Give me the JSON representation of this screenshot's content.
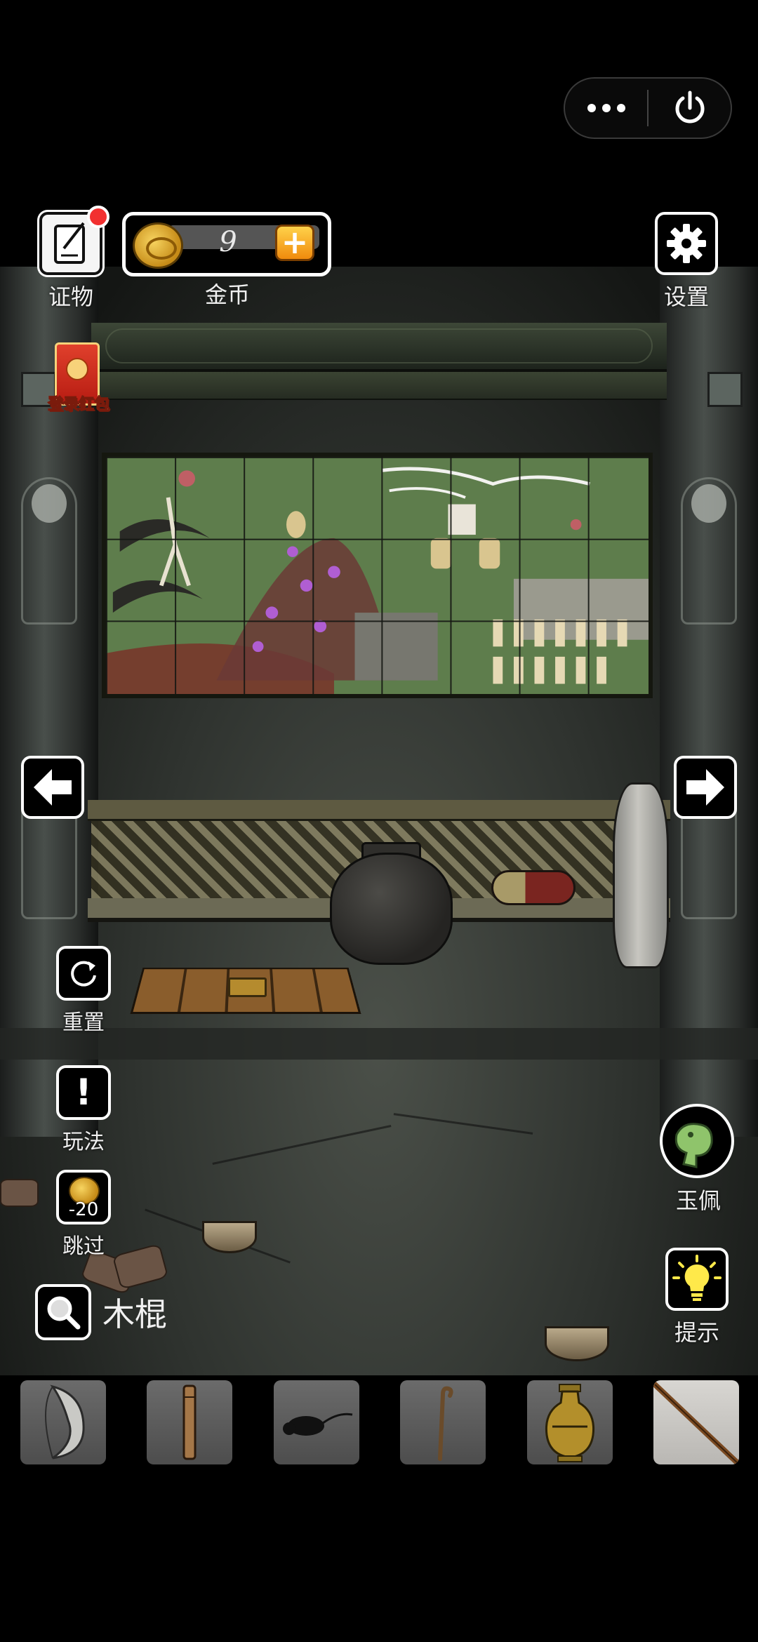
{
  "hud": {
    "evidence_label": "证物",
    "coins_label": "金币",
    "coins_value": "9",
    "settings_label": "设置",
    "redpacket_label": "登录红包",
    "reset_label": "重置",
    "howto_label": "玩法",
    "skip_label": "跳过",
    "skip_cost": "-20",
    "hint_label": "提示",
    "selected_item_label": "玉佩",
    "found_item_name": "木棍"
  },
  "icons": {
    "capsule_more": "more-dots-icon",
    "capsule_exit": "power-icon",
    "evidence": "notebook-pen-icon",
    "coin": "gold-coin-icon",
    "plus": "plus-icon",
    "settings": "gear-icon",
    "nav_left": "arrow-left-icon",
    "nav_right": "arrow-right-icon",
    "reset": "refresh-icon",
    "howto": "exclamation-icon",
    "hint": "lightbulb-icon",
    "search": "magnifier-icon"
  },
  "inventory": [
    {
      "name": "crescent-stone"
    },
    {
      "name": "wooden-tube"
    },
    {
      "name": "dead-rat"
    },
    {
      "name": "walking-cane"
    },
    {
      "name": "bronze-vase"
    },
    {
      "name": "wooden-stick",
      "selected": true
    }
  ],
  "colors": {
    "coin_gold": "#f0b521",
    "plus_orange": "#f5a11c",
    "notification_red": "#f23030",
    "hint_yellow": "#ffe94a",
    "jade_green": "#8fc46b",
    "mural_green": "#5e7d4c"
  }
}
